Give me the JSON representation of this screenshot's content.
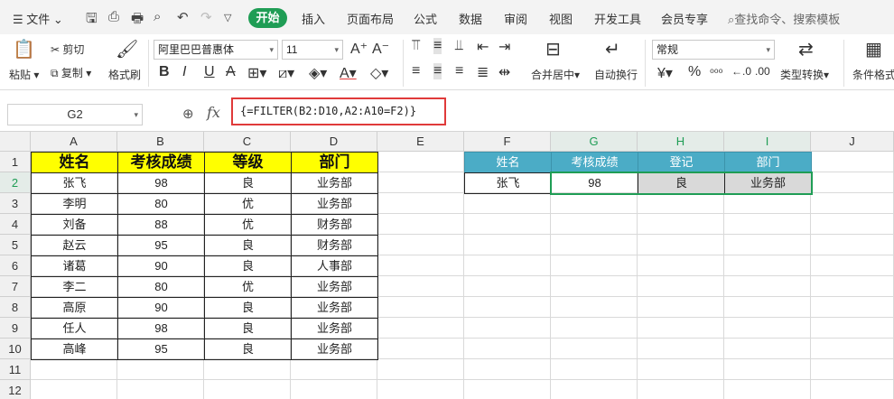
{
  "menubar": {
    "file": "文件",
    "tabs": [
      "开始",
      "插入",
      "页面布局",
      "公式",
      "数据",
      "审阅",
      "视图",
      "开发工具",
      "会员专享"
    ],
    "search": "查找命令、搜索模板"
  },
  "ribbon": {
    "paste": "粘贴",
    "cut": "剪切",
    "copy": "复制",
    "format_painter": "格式刷",
    "font_name": "阿里巴巴普惠体",
    "font_size": "11",
    "merge_center": "合并居中",
    "wrap_text": "自动换行",
    "number_format": "常规",
    "type_convert": "类型转换",
    "conditional_format": "条件格式"
  },
  "formula_bar": {
    "name_box": "G2",
    "fx": "fx",
    "formula": "{=FILTER(B2:D10,A2:A10=F2)}"
  },
  "sheet": {
    "columns": [
      "A",
      "B",
      "C",
      "D",
      "E",
      "F",
      "G",
      "H",
      "I",
      "J"
    ],
    "rows": [
      "1",
      "2",
      "3",
      "4",
      "5",
      "6",
      "7",
      "8",
      "9",
      "10",
      "11",
      "12"
    ],
    "left_table": {
      "headers": [
        "姓名",
        "考核成绩",
        "等级",
        "部门"
      ],
      "rows": [
        [
          "张飞",
          "98",
          "良",
          "业务部"
        ],
        [
          "李明",
          "80",
          "优",
          "业务部"
        ],
        [
          "刘备",
          "88",
          "优",
          "财务部"
        ],
        [
          "赵云",
          "95",
          "良",
          "财务部"
        ],
        [
          "诸葛",
          "90",
          "良",
          "人事部"
        ],
        [
          "李二",
          "80",
          "优",
          "业务部"
        ],
        [
          "高原",
          "90",
          "良",
          "业务部"
        ],
        [
          "任人",
          "98",
          "良",
          "业务部"
        ],
        [
          "高峰",
          "95",
          "良",
          "业务部"
        ]
      ]
    },
    "right_table": {
      "headers": [
        "姓名",
        "考核成绩",
        "登记",
        "部门"
      ],
      "row": [
        "张飞",
        "98",
        "良",
        "业务部"
      ]
    }
  },
  "colors": {
    "accent": "#1f9d55",
    "yellow_header": "#ffff00",
    "blue_header": "#4bacc6",
    "formula_highlight": "#e03a3a"
  }
}
